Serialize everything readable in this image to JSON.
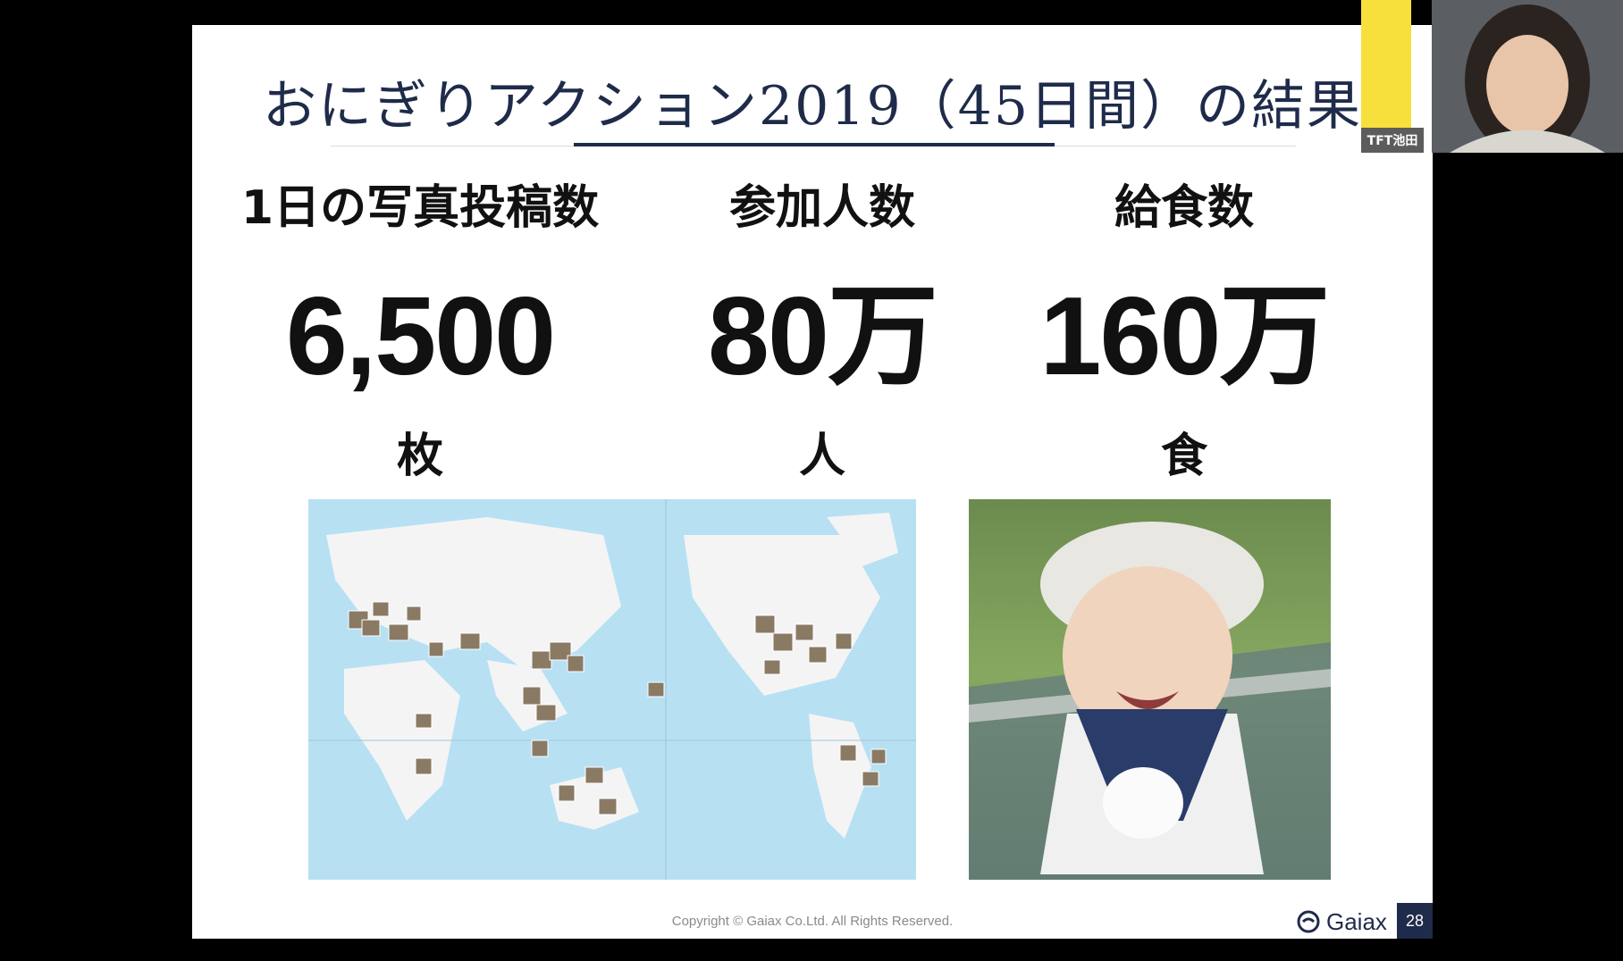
{
  "slide": {
    "title": "おにぎりアクション2019（45日間）の結果",
    "stats": [
      {
        "label": "1日の写真投稿数",
        "value": "6,500",
        "unit": "枚"
      },
      {
        "label": "参加人数",
        "value": "80万",
        "unit": "人"
      },
      {
        "label": "給食数",
        "value": "160万",
        "unit": "食"
      }
    ],
    "footer": {
      "copyright": "Copyright © Gaiax Co.Ltd. All Rights Reserved.",
      "logo_text": "Gaiax",
      "page_number": "28"
    }
  },
  "video_call": {
    "participant_label": "TFT池田"
  },
  "colors": {
    "navy": "#1f2b4a",
    "map_ocean": "#b7e0f3",
    "map_land": "#f4f4f4",
    "poster_yellow": "#f7e03b"
  }
}
